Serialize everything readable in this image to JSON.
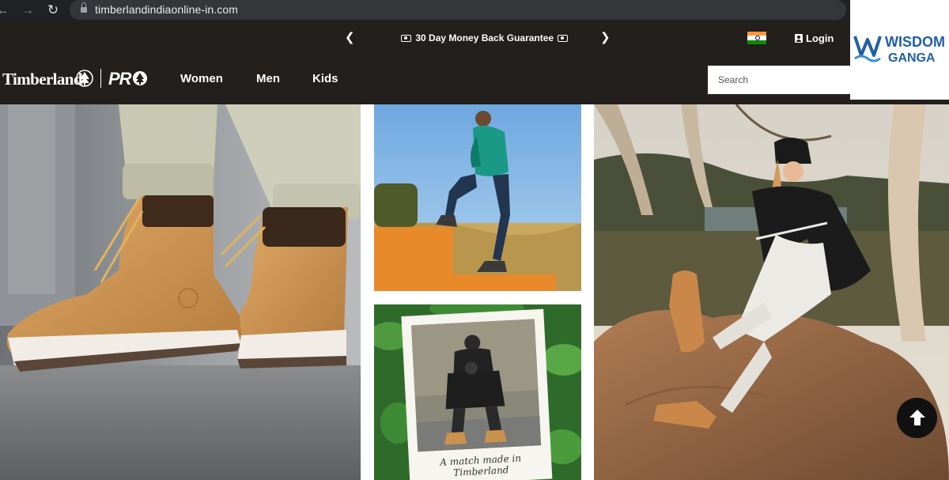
{
  "browser": {
    "url": "timberlandindiaonline-in.com"
  },
  "header": {
    "promo_text": "30 Day Money Back Guarantee",
    "login_label": "Login",
    "logo_text": "Timberland",
    "logo_pro_text": "PR",
    "nav": {
      "women": "Women",
      "men": "Men",
      "kids": "Kids"
    },
    "search_placeholder": "Search"
  },
  "watermark": {
    "line1": "WISDOM",
    "line2": "GANGA"
  },
  "hero": {
    "polaroid_caption": "A match made in Timberland"
  },
  "icons": {
    "back": "arrow-left-icon",
    "forward": "arrow-right-icon",
    "reload": "reload-icon",
    "lock": "lock-icon",
    "share": "share-icon",
    "bookmark": "star-icon",
    "promo_prev": "chevron-left-icon",
    "promo_next": "chevron-right-icon",
    "money": "money-icon",
    "flag": "india-flag-icon",
    "user": "user-icon",
    "scroll_top": "arrow-up-icon"
  },
  "colors": {
    "header_bg": "#221f1d",
    "browser_bg": "#202124",
    "watermark_blue": "#1f5fa8",
    "boot_wheat": "#c9924f"
  }
}
